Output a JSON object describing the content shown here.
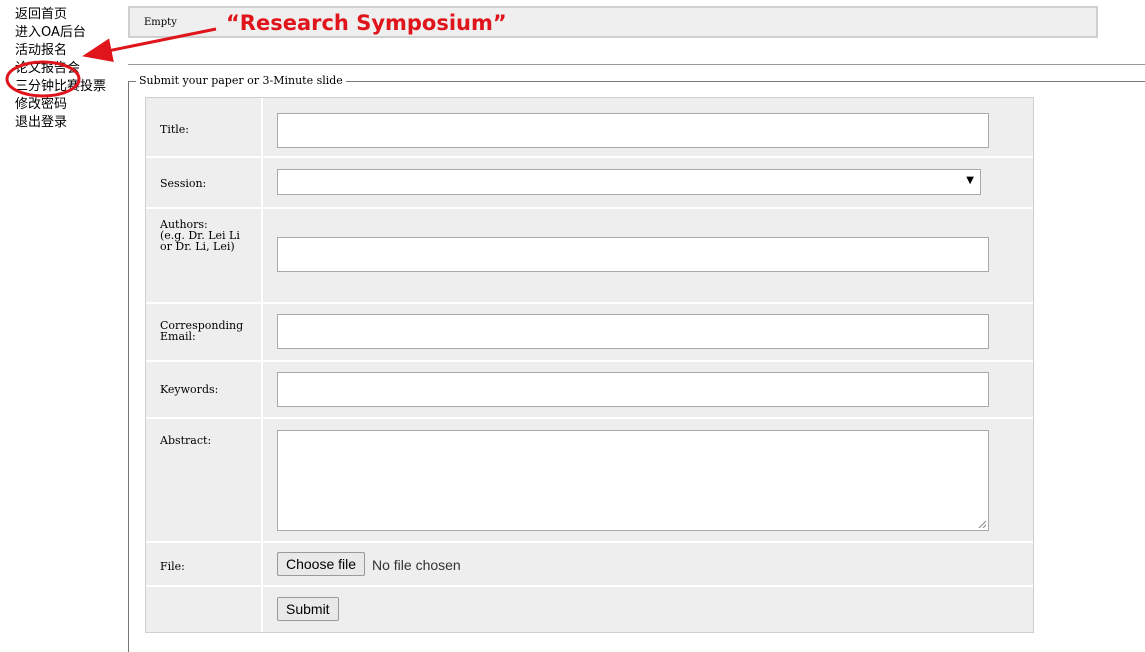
{
  "nav": {
    "items": [
      {
        "label": "返回首页"
      },
      {
        "label": "进入OA后台"
      },
      {
        "label": "活动报名"
      },
      {
        "label": "论文报告会"
      },
      {
        "label": "三分钟比赛投票"
      },
      {
        "label": "修改密码"
      },
      {
        "label": "退出登录"
      }
    ]
  },
  "status": {
    "text": "Empty"
  },
  "annotation": {
    "text": "“Research Symposium”",
    "color": "#e0141b"
  },
  "form": {
    "legend": "Submit your paper or 3-Minute slide",
    "title_label": "Title:",
    "session_label": "Session:",
    "authors_label": "Authors:\n(e.g. Dr. Lei Li\nor Dr. Li, Lei)",
    "email_label": "Corresponding Email:",
    "keywords_label": "Keywords:",
    "abstract_label": "Abstract:",
    "file_label": "File:",
    "choose_file_label": "Choose file",
    "file_status": "No file chosen",
    "submit_label": "Submit"
  },
  "icons": {
    "select_arrow": "dropdown-arrow-icon",
    "resize": "resize-grip-icon"
  }
}
